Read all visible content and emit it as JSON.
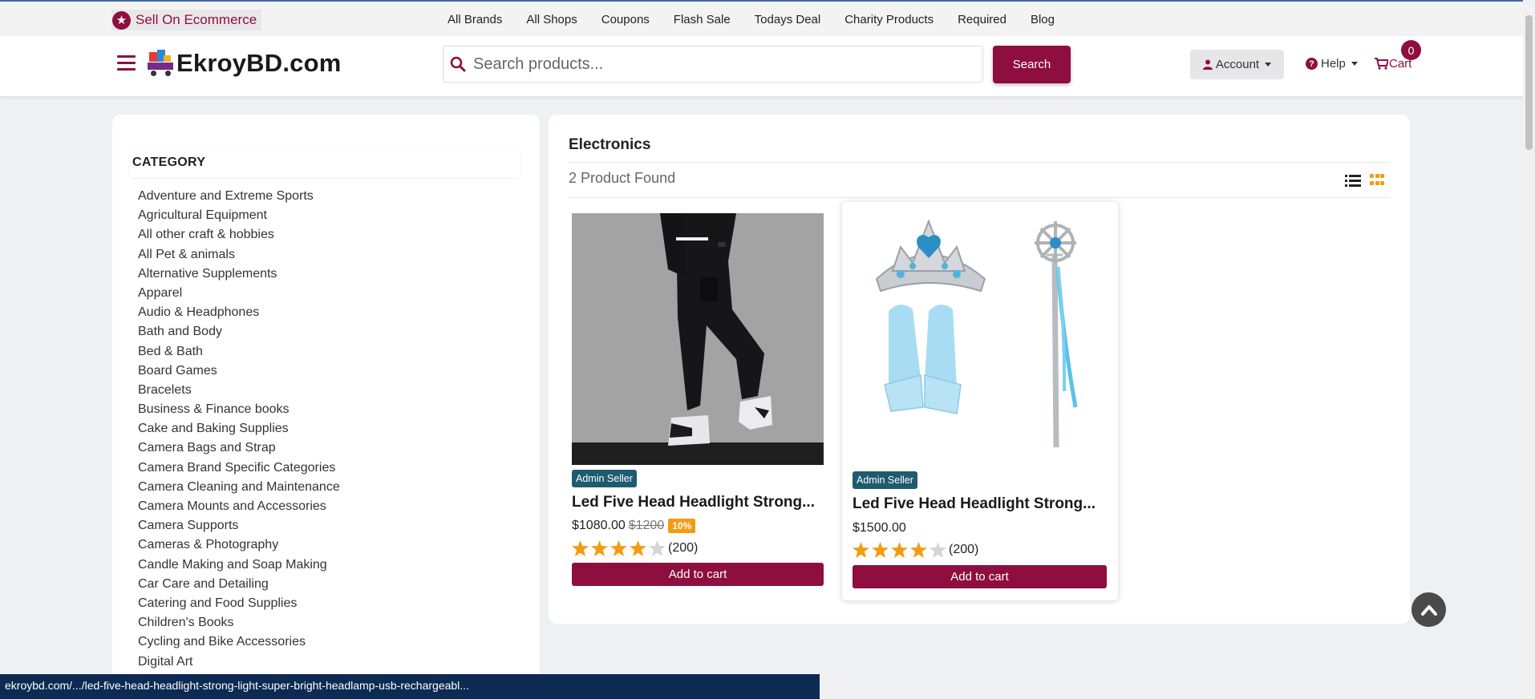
{
  "topbar": {
    "sell_label": "Sell On Ecommerce",
    "nav": [
      "All Brands",
      "All Shops",
      "Coupons",
      "Flash Sale",
      "Todays Deal",
      "Charity Products",
      "Required",
      "Blog"
    ]
  },
  "header": {
    "logo_text": "EkroyBD.com",
    "search_placeholder": "Search products...",
    "search_button": "Search",
    "account_label": "Account",
    "help_label": "Help",
    "cart_label": "Cart",
    "cart_count": "0"
  },
  "sidebar": {
    "title": "CATEGORY",
    "categories": [
      "Adventure and Extreme Sports",
      "Agricultural Equipment",
      "All other craft & hobbies",
      "All Pet & animals",
      "Alternative Supplements",
      "Apparel",
      "Audio & Headphones",
      "Bath and Body",
      "Bed & Bath",
      "Board Games",
      "Bracelets",
      "Business & Finance books",
      "Cake and Baking Supplies",
      "Camera Bags and Strap",
      "Camera Brand Specific Categories",
      "Camera Cleaning and Maintenance",
      "Camera Mounts and Accessories",
      "Camera Supports",
      "Cameras & Photography",
      "Candle Making and Soap Making",
      "Car Care and Detailing",
      "Catering and Food Supplies",
      "Children's Books",
      "Cycling and Bike Accessories",
      "Digital Art"
    ]
  },
  "main": {
    "category_title": "Electronics",
    "found_text": "2 Product Found",
    "products": [
      {
        "seller_badge": "Admin Seller",
        "title": "Led Five Head Headlight Strong...",
        "price": "$1080.00",
        "old_price": "$1200",
        "discount": "10%",
        "rating": 4,
        "reviews": "(200)",
        "button": "Add to cart"
      },
      {
        "seller_badge": "Admin Seller",
        "title": "Led Five Head Headlight Strong...",
        "price": "$1500.00",
        "rating": 4,
        "reviews": "(200)",
        "button": "Add to cart"
      }
    ]
  },
  "status_url": "ekroybd.com/.../led-five-head-headlight-strong-light-super-bright-headlamp-usb-rechargeabl...",
  "colors": {
    "brand": "#8e0e3f",
    "star": "#f39c12",
    "badge": "#1e5b6f"
  }
}
